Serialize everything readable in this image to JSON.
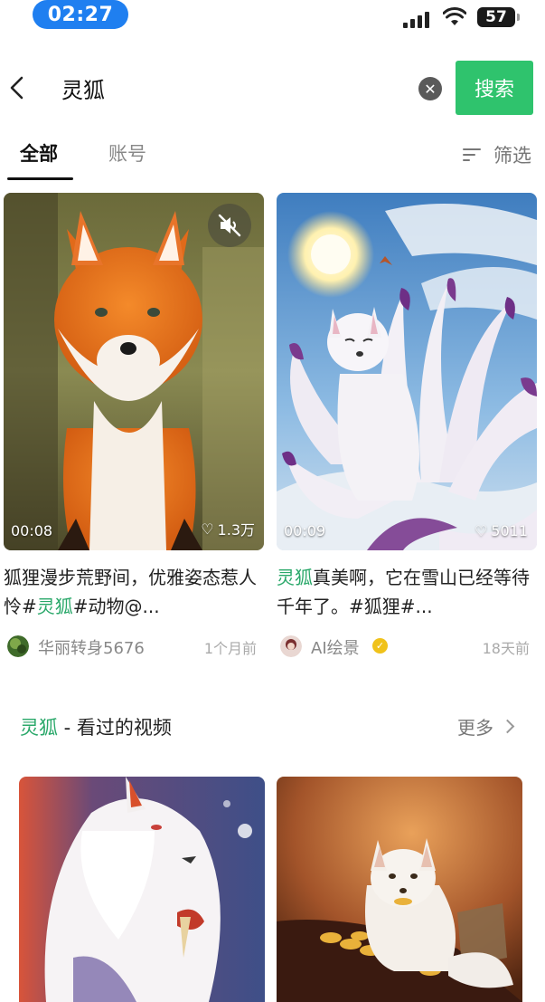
{
  "status_bar": {
    "time": "02:27",
    "battery": "57"
  },
  "search": {
    "query": "灵狐",
    "button_label": "搜索"
  },
  "tabs": [
    {
      "label": "全部",
      "active": true
    },
    {
      "label": "账号",
      "active": false
    }
  ],
  "filter": {
    "label": "筛选"
  },
  "results": [
    {
      "duration": "00:08",
      "likes": "1.3万",
      "caption_parts": [
        "狐狸漫步荒野间，优雅姿态惹人怜#",
        "灵狐",
        "#动物@..."
      ],
      "author": "华丽转身5676",
      "time": "1个月前",
      "muted": true
    },
    {
      "duration": "00:09",
      "likes": "5011",
      "caption_parts": [
        "",
        "灵狐",
        "真美啊，它在雪山已经等待千年了。#狐狸#..."
      ],
      "author": "AI绘景",
      "time": "18天前",
      "verified": true
    }
  ],
  "viewed_section": {
    "keyword": "灵狐",
    "title_suffix": " - 看过的视频",
    "more_label": "更多"
  },
  "colors": {
    "accent_green": "#2fc36d",
    "highlight_green": "#2aa86a",
    "time_pill": "#1f7ff0"
  }
}
